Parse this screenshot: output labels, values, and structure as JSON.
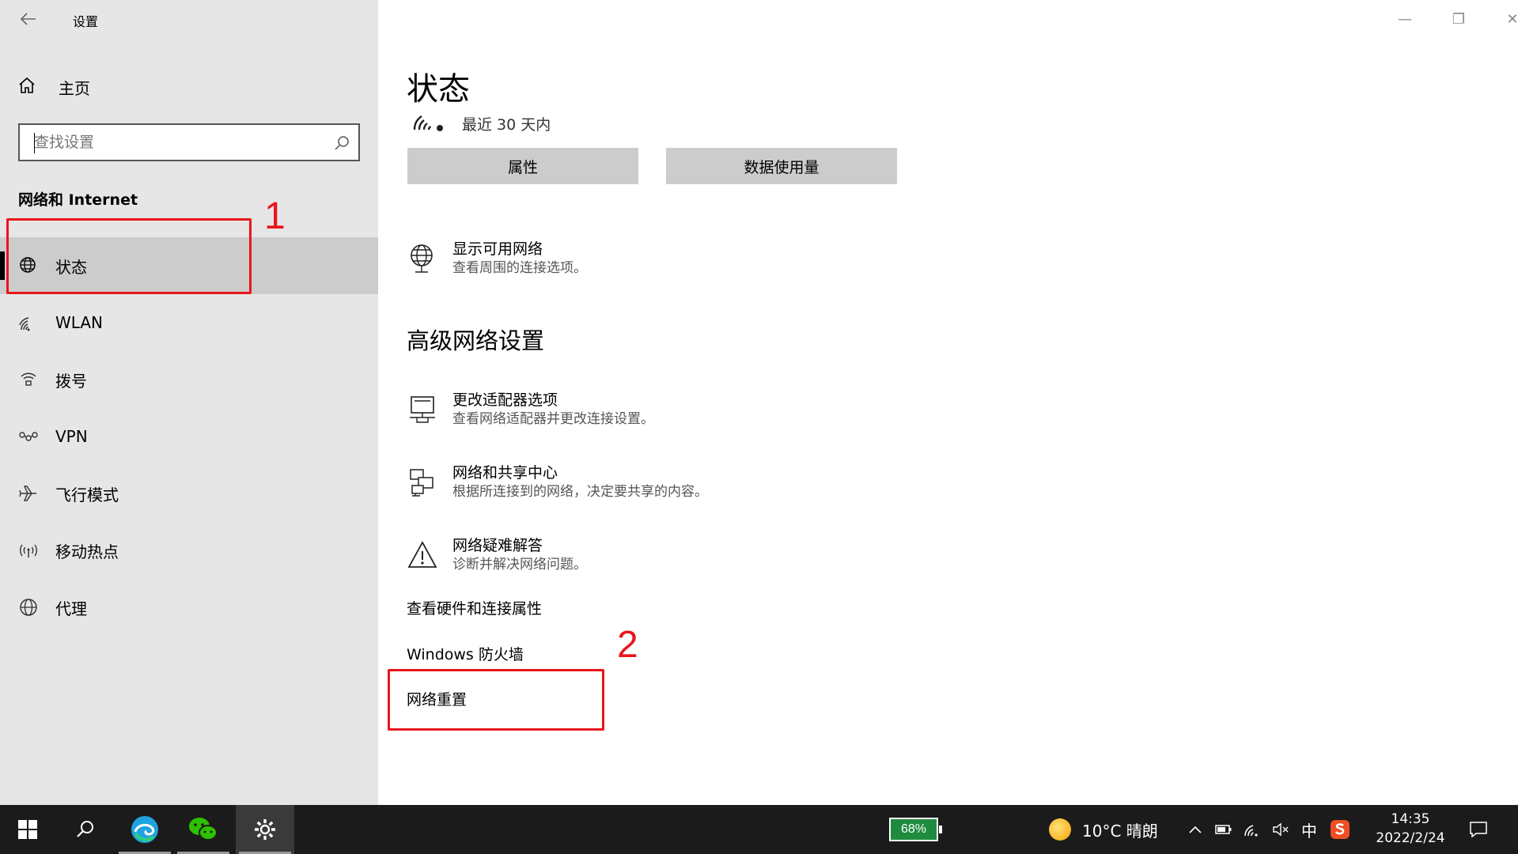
{
  "window": {
    "title": "设置",
    "back_icon": "back-arrow-icon",
    "controls": {
      "minimize": "—",
      "maximize": "❐",
      "close": "✕"
    }
  },
  "sidebar": {
    "home_label": "主页",
    "search_placeholder": "查找设置",
    "section_title": "网络和 Internet",
    "items": [
      {
        "label": "状态",
        "icon": "globe-status-icon",
        "selected": true
      },
      {
        "label": "WLAN",
        "icon": "wifi-icon",
        "selected": false
      },
      {
        "label": "拨号",
        "icon": "dialup-icon",
        "selected": false
      },
      {
        "label": "VPN",
        "icon": "vpn-icon",
        "selected": false
      },
      {
        "label": "飞行模式",
        "icon": "airplane-icon",
        "selected": false
      },
      {
        "label": "移动热点",
        "icon": "hotspot-icon",
        "selected": false
      },
      {
        "label": "代理",
        "icon": "globe-icon",
        "selected": false
      }
    ]
  },
  "main": {
    "title": "状态",
    "status_text": "最近 30 天内",
    "buttons": {
      "properties": "属性",
      "data_usage": "数据使用量"
    },
    "show_networks": {
      "title": "显示可用网络",
      "desc": "查看周围的连接选项。"
    },
    "advanced_heading": "高级网络设置",
    "adapter": {
      "title": "更改适配器选项",
      "desc": "查看网络适配器并更改连接设置。"
    },
    "sharing": {
      "title": "网络和共享中心",
      "desc": "根据所连接到的网络，决定要共享的内容。"
    },
    "troubleshoot": {
      "title": "网络疑难解答",
      "desc": "诊断并解决网络问题。"
    },
    "links": {
      "hardware": "查看硬件和连接属性",
      "firewall": "Windows 防火墙",
      "reset": "网络重置"
    }
  },
  "annotations": {
    "one": "1",
    "two": "2",
    "color": "#e8161b"
  },
  "taskbar": {
    "battery": "68%",
    "weather": "10°C 晴朗",
    "ime": "中",
    "time": "14:35",
    "date": "2022/2/24"
  }
}
